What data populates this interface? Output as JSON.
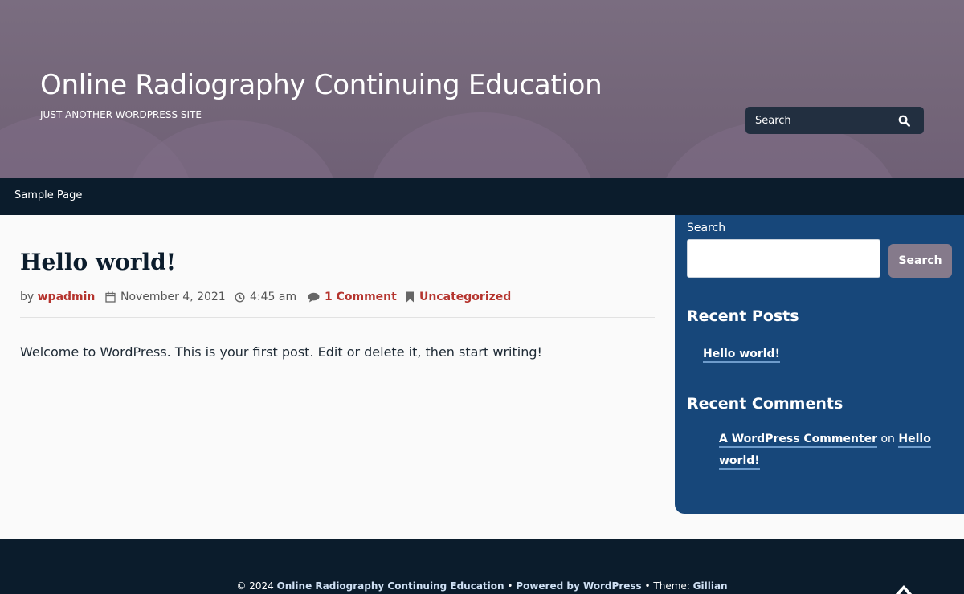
{
  "header": {
    "site_title": "Online Radiography Continuing Education",
    "site_description": "JUST ANOTHER WORDPRESS SITE",
    "search_placeholder": "Search",
    "search_icon": "search-icon"
  },
  "nav": {
    "items": [
      {
        "label": "Sample Page"
      }
    ]
  },
  "post": {
    "title": "Hello world!",
    "by_label": "by",
    "author": "wpadmin",
    "date": "November 4, 2021",
    "time": "4:45 am",
    "comments": "1 Comment",
    "category": "Uncategorized",
    "body": "Welcome to WordPress. This is your first post. Edit or delete it, then start writing!"
  },
  "sidebar": {
    "search_label": "Search",
    "search_button": "Search",
    "recent_posts_heading": "Recent Posts",
    "recent_posts": [
      {
        "title": "Hello world!"
      }
    ],
    "recent_comments_heading": "Recent Comments",
    "recent_comments": [
      {
        "author": "A WordPress Commenter",
        "on": "on",
        "post_part1": "Hello",
        "post_part2": "world!"
      }
    ]
  },
  "footer": {
    "copyright": "© 2024",
    "site_name": "Online Radiography Continuing Education",
    "bullet": "•",
    "powered_by": "Powered by WordPress",
    "theme_prefix": "Theme:",
    "theme_name": "Gillian"
  },
  "colors": {
    "header_bg": "#766879",
    "nav_bg": "#0b1c2c",
    "sidebar_bg": "#17477a",
    "accent_red": "#b5342e",
    "sidebar_button": "#857a8b"
  }
}
